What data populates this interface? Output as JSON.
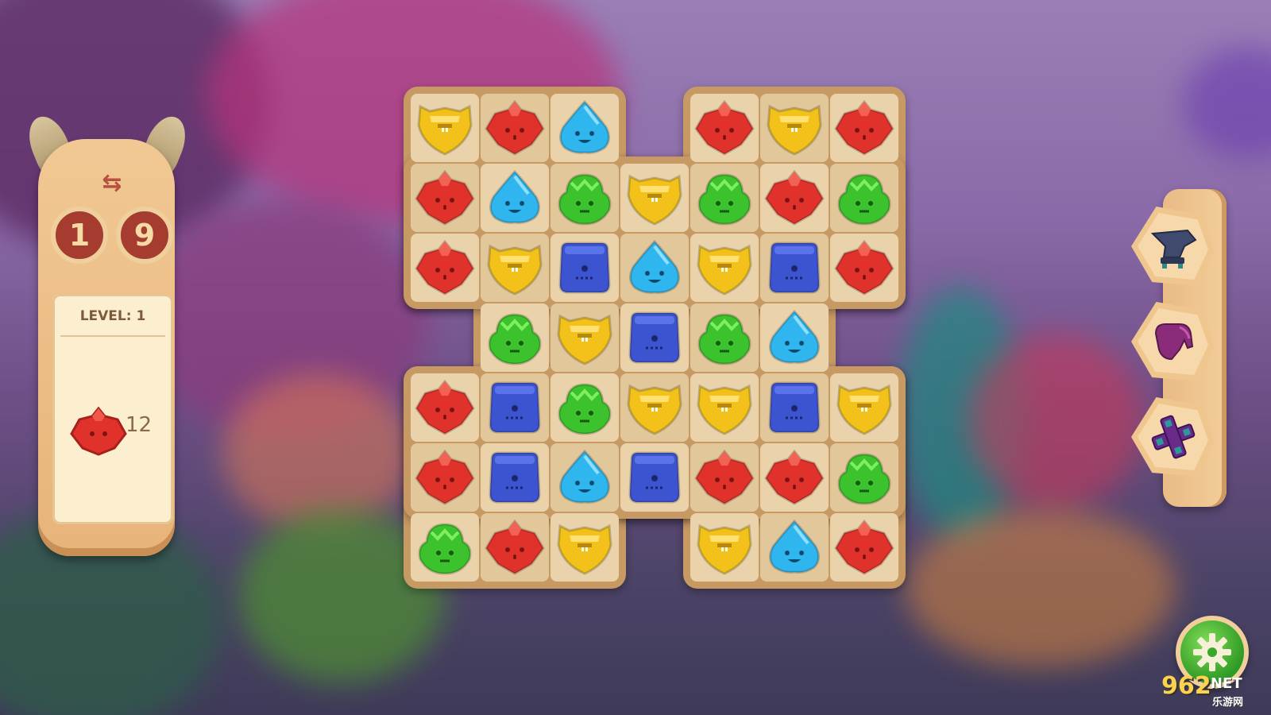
{
  "game": {
    "moves_digits": [
      "1",
      "9"
    ],
    "level_label": "LEVEL: 1",
    "goal": {
      "gem": "red",
      "count": "12"
    }
  },
  "board": {
    "rows": [
      [
        "yellow",
        "red",
        "blue",
        null,
        "red",
        "yellow",
        "red"
      ],
      [
        "red",
        "blue",
        "green",
        "yellow",
        "green",
        "red",
        "green"
      ],
      [
        "red",
        "yellow",
        "navy",
        "blue",
        "yellow",
        "navy",
        "red"
      ],
      [
        null,
        "green",
        "yellow",
        "navy",
        "green",
        "blue",
        null
      ],
      [
        "red",
        "navy",
        "green",
        "yellow",
        "yellow",
        "navy",
        "yellow"
      ],
      [
        "red",
        "navy",
        "blue",
        "navy",
        "red",
        "red",
        "green"
      ],
      [
        "green",
        "red",
        "yellow",
        null,
        "yellow",
        "blue",
        "red"
      ]
    ]
  },
  "tools": [
    {
      "name": "anvil-icon",
      "color": "#3f4a6e"
    },
    {
      "name": "glove-icon",
      "color": "#8a2c7a"
    },
    {
      "name": "cross-icon",
      "color": "#6a2a8a"
    }
  ],
  "colors": {
    "red": "#e0322b",
    "yellow": "#f2c21b",
    "blue": "#2fb6ee",
    "green": "#3cc22c",
    "navy": "#3c54cf"
  },
  "watermark": {
    "num": "962",
    "net": "NET",
    "sub": "乐游网"
  }
}
